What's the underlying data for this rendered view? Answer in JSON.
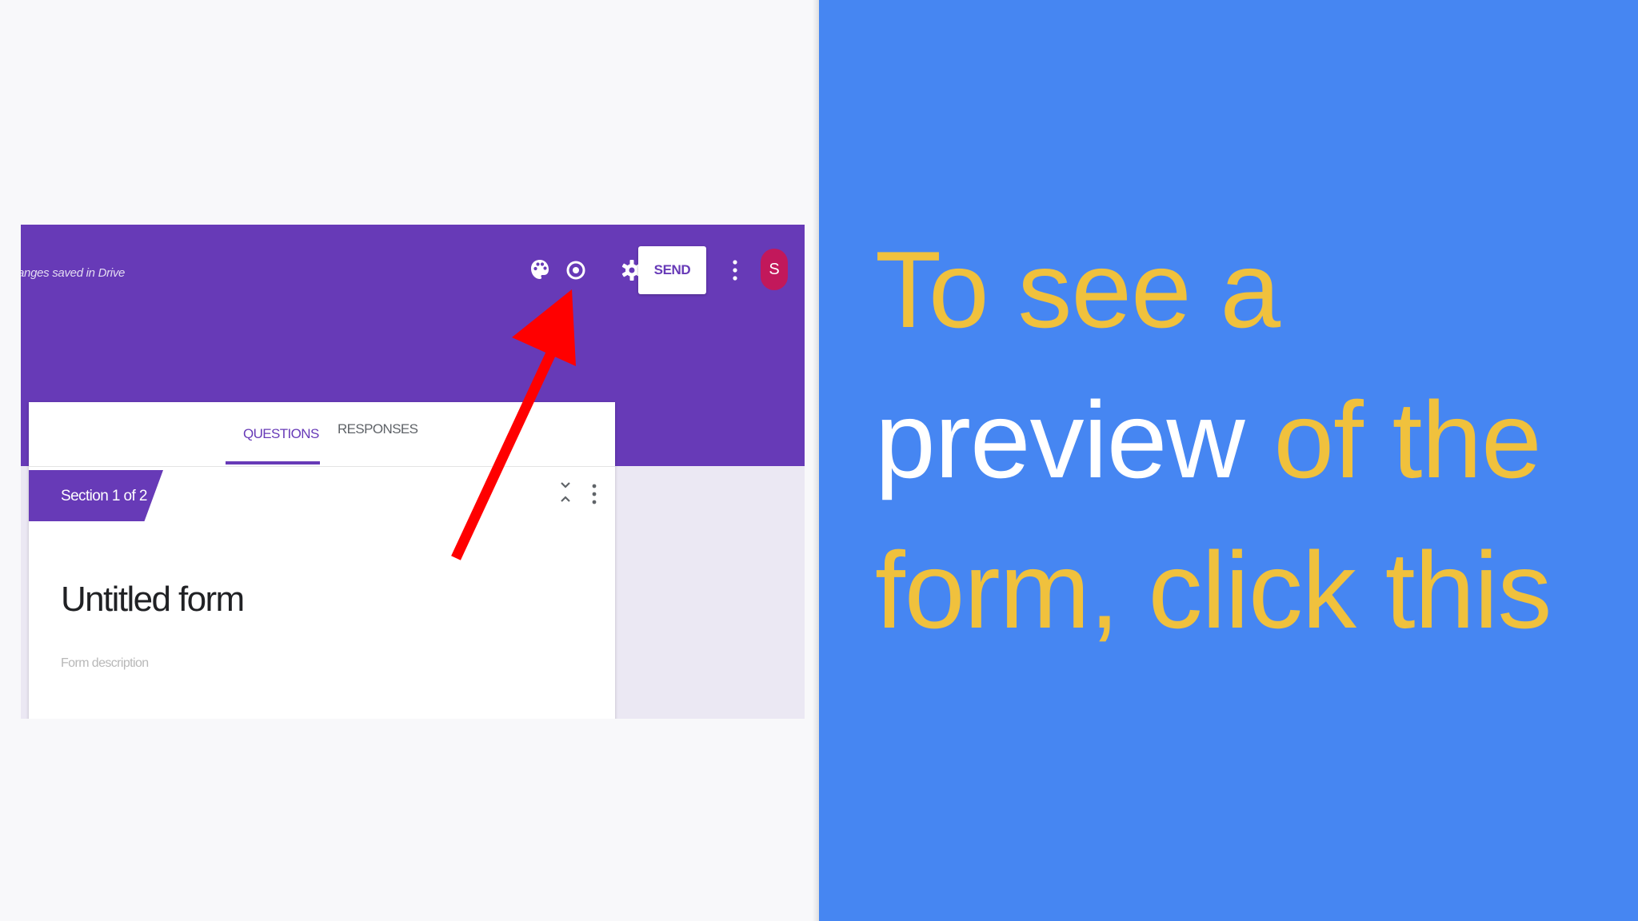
{
  "screenshot": {
    "saved_status": "anges saved in Drive",
    "toolbar": {
      "palette_icon": "palette-icon",
      "preview_icon": "eye-icon",
      "settings_icon": "gear-icon",
      "send_label": "SEND",
      "more_icon": "more-vert-icon",
      "avatar_initial": "S"
    },
    "tabs": [
      {
        "label": "QUESTIONS",
        "active": true
      },
      {
        "label": "RESPONSES",
        "active": false
      }
    ],
    "section_label": "Section 1 of 2",
    "form_title": "Untitled form",
    "form_description_placeholder": "Form description"
  },
  "caption": {
    "line1": "To see a",
    "line2_highlight": "preview",
    "line2_rest": " of the",
    "line3": "form, click this"
  },
  "colors": {
    "forms_purple": "#673ab7",
    "panel_blue": "#4686f2",
    "caption_yellow": "#f0c13d",
    "caption_white": "#ffffff",
    "arrow_red": "#ff0000",
    "avatar_pink": "#c2185b"
  }
}
